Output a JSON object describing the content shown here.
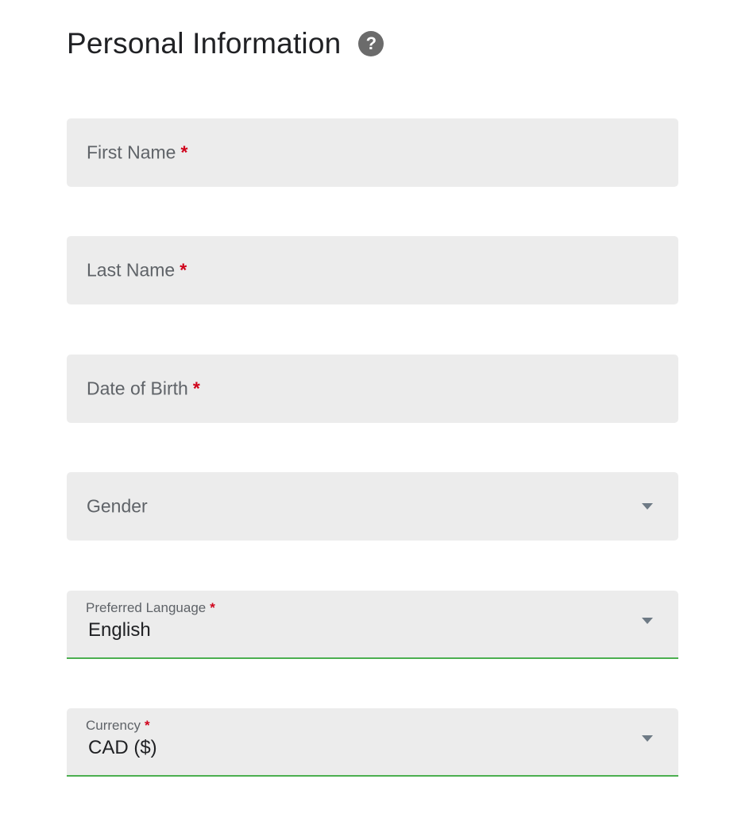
{
  "header": {
    "title": "Personal Information",
    "help_glyph": "?"
  },
  "form": {
    "required_marker": "*",
    "first_name": {
      "label": "First Name"
    },
    "last_name": {
      "label": "Last Name"
    },
    "date_of_birth": {
      "label": "Date of Birth"
    },
    "gender": {
      "label": "Gender"
    },
    "preferred_language": {
      "label": "Preferred Language",
      "value": "English"
    },
    "currency": {
      "label": "Currency",
      "value": "CAD ($)"
    }
  },
  "colors": {
    "field_background": "#ececec",
    "required": "#d0021b",
    "active_underline": "#4caf50",
    "help_icon": "#6b6b6b"
  },
  "icons": {
    "help": "help-circle-icon",
    "dropdown": "triangle-down-icon"
  }
}
